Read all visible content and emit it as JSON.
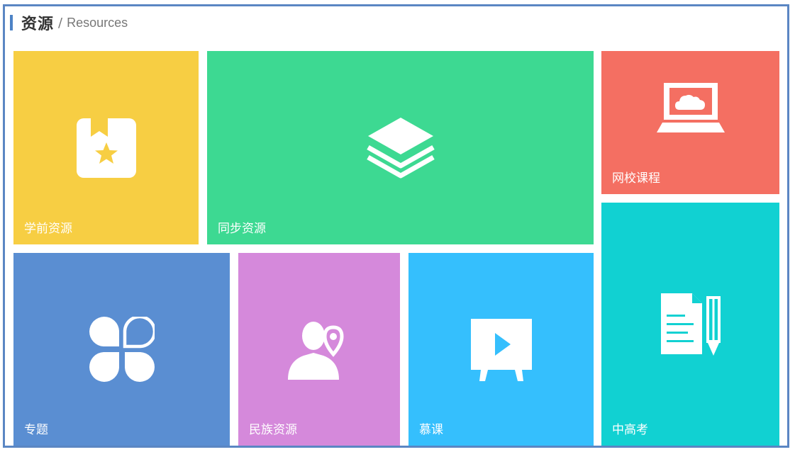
{
  "header": {
    "title_cn": "资源",
    "separator": "/",
    "title_en": "Resources"
  },
  "tiles": [
    {
      "label": "学前资源",
      "icon": "bookmark-star-icon",
      "color": "#f7ce43"
    },
    {
      "label": "同步资源",
      "icon": "layers-icon",
      "color": "#3dd992"
    },
    {
      "label": "网校课程",
      "icon": "laptop-cloud-icon",
      "color": "#f46f62"
    },
    {
      "label": "专题",
      "icon": "clover-icon",
      "color": "#5a8ed2"
    },
    {
      "label": "民族资源",
      "icon": "person-location-icon",
      "color": "#d589db"
    },
    {
      "label": "慕课",
      "icon": "video-board-icon",
      "color": "#35bffd"
    },
    {
      "label": "中高考",
      "icon": "document-pencil-icon",
      "color": "#11d1d2"
    }
  ],
  "colors": {
    "frame_border": "#5b86c3",
    "header_accent": "#4d83c6"
  }
}
